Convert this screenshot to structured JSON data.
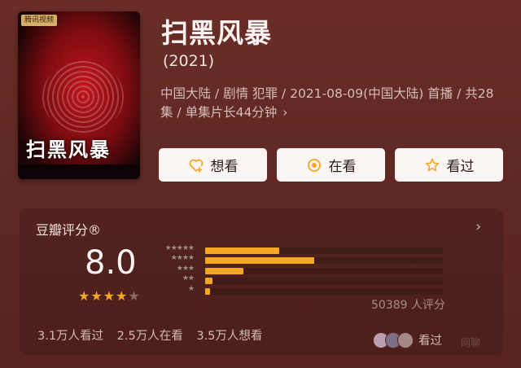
{
  "poster": {
    "badge": "腾讯视频",
    "title_art": "扫黑风暴"
  },
  "title": "扫黑风暴",
  "year": "(2021)",
  "meta": "中国大陆 / 剧情 犯罪 / 2021-08-09(中国大陆) 首播 / 共28集 / 单集片长44分钟",
  "meta_chevron": "›",
  "buttons": {
    "want": {
      "label": "想看",
      "icon": "heart-plus-icon"
    },
    "watching": {
      "label": "在看",
      "icon": "dot-circle-icon"
    },
    "watched": {
      "label": "看过",
      "icon": "star-outline-icon"
    }
  },
  "rating": {
    "label": "豆瓣评分®",
    "chevron": "›",
    "score": "8.0",
    "stars": 4,
    "votes": "50389 人评分",
    "distribution": [
      {
        "stars": "★★★★★",
        "fraction": 0.31
      },
      {
        "stars": "★★★★",
        "fraction": 0.46
      },
      {
        "stars": "★★★",
        "fraction": 0.16
      },
      {
        "stars": "★★",
        "fraction": 0.03
      },
      {
        "stars": "★",
        "fraction": 0.02
      }
    ]
  },
  "stats": {
    "watched": "3.1万人看过",
    "watching": "2.5万人在看",
    "want": "3.5万人想看"
  },
  "watched_link": "看过",
  "watermark": "网聊",
  "colors": {
    "accent": "#f5a623",
    "background": "#5a2621",
    "button_bg": "#fbf6f4"
  }
}
